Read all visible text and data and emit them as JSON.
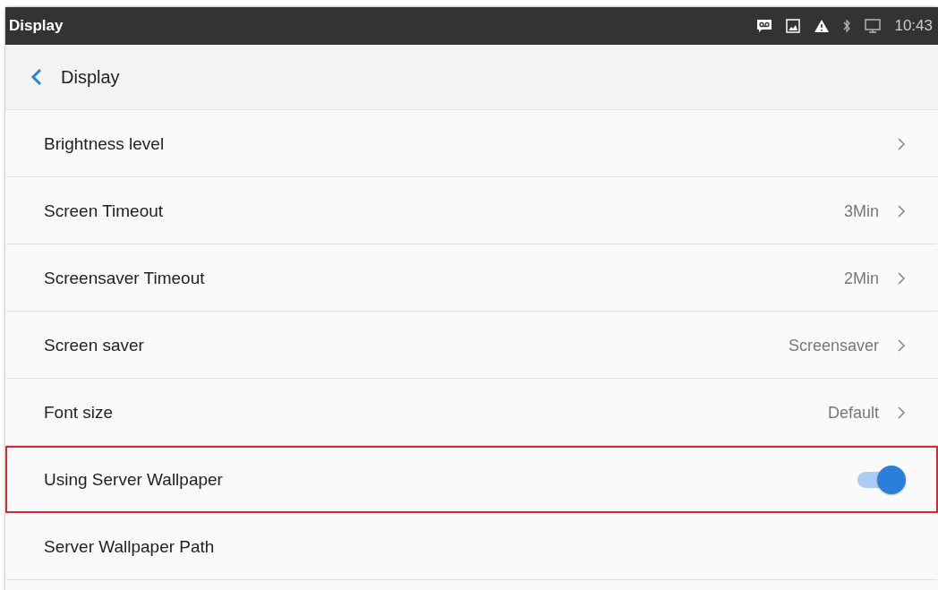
{
  "status_bar": {
    "title": "Display",
    "time": "10:43"
  },
  "header": {
    "title": "Display"
  },
  "rows": [
    {
      "kind": "link",
      "label": "Brightness level",
      "highlighted": false
    },
    {
      "kind": "link",
      "label": "Screen Timeout",
      "value": "3Min",
      "highlighted": false
    },
    {
      "kind": "link",
      "label": "Screensaver Timeout",
      "value": "2Min",
      "highlighted": false
    },
    {
      "kind": "link",
      "label": "Screen saver",
      "value": "Screensaver",
      "highlighted": false
    },
    {
      "kind": "link",
      "label": "Font size",
      "value": "Default",
      "highlighted": false
    },
    {
      "kind": "toggle",
      "label": "Using Server Wallpaper",
      "on": true,
      "highlighted": true
    },
    {
      "kind": "plain",
      "label": "Server Wallpaper Path",
      "highlighted": false
    }
  ]
}
